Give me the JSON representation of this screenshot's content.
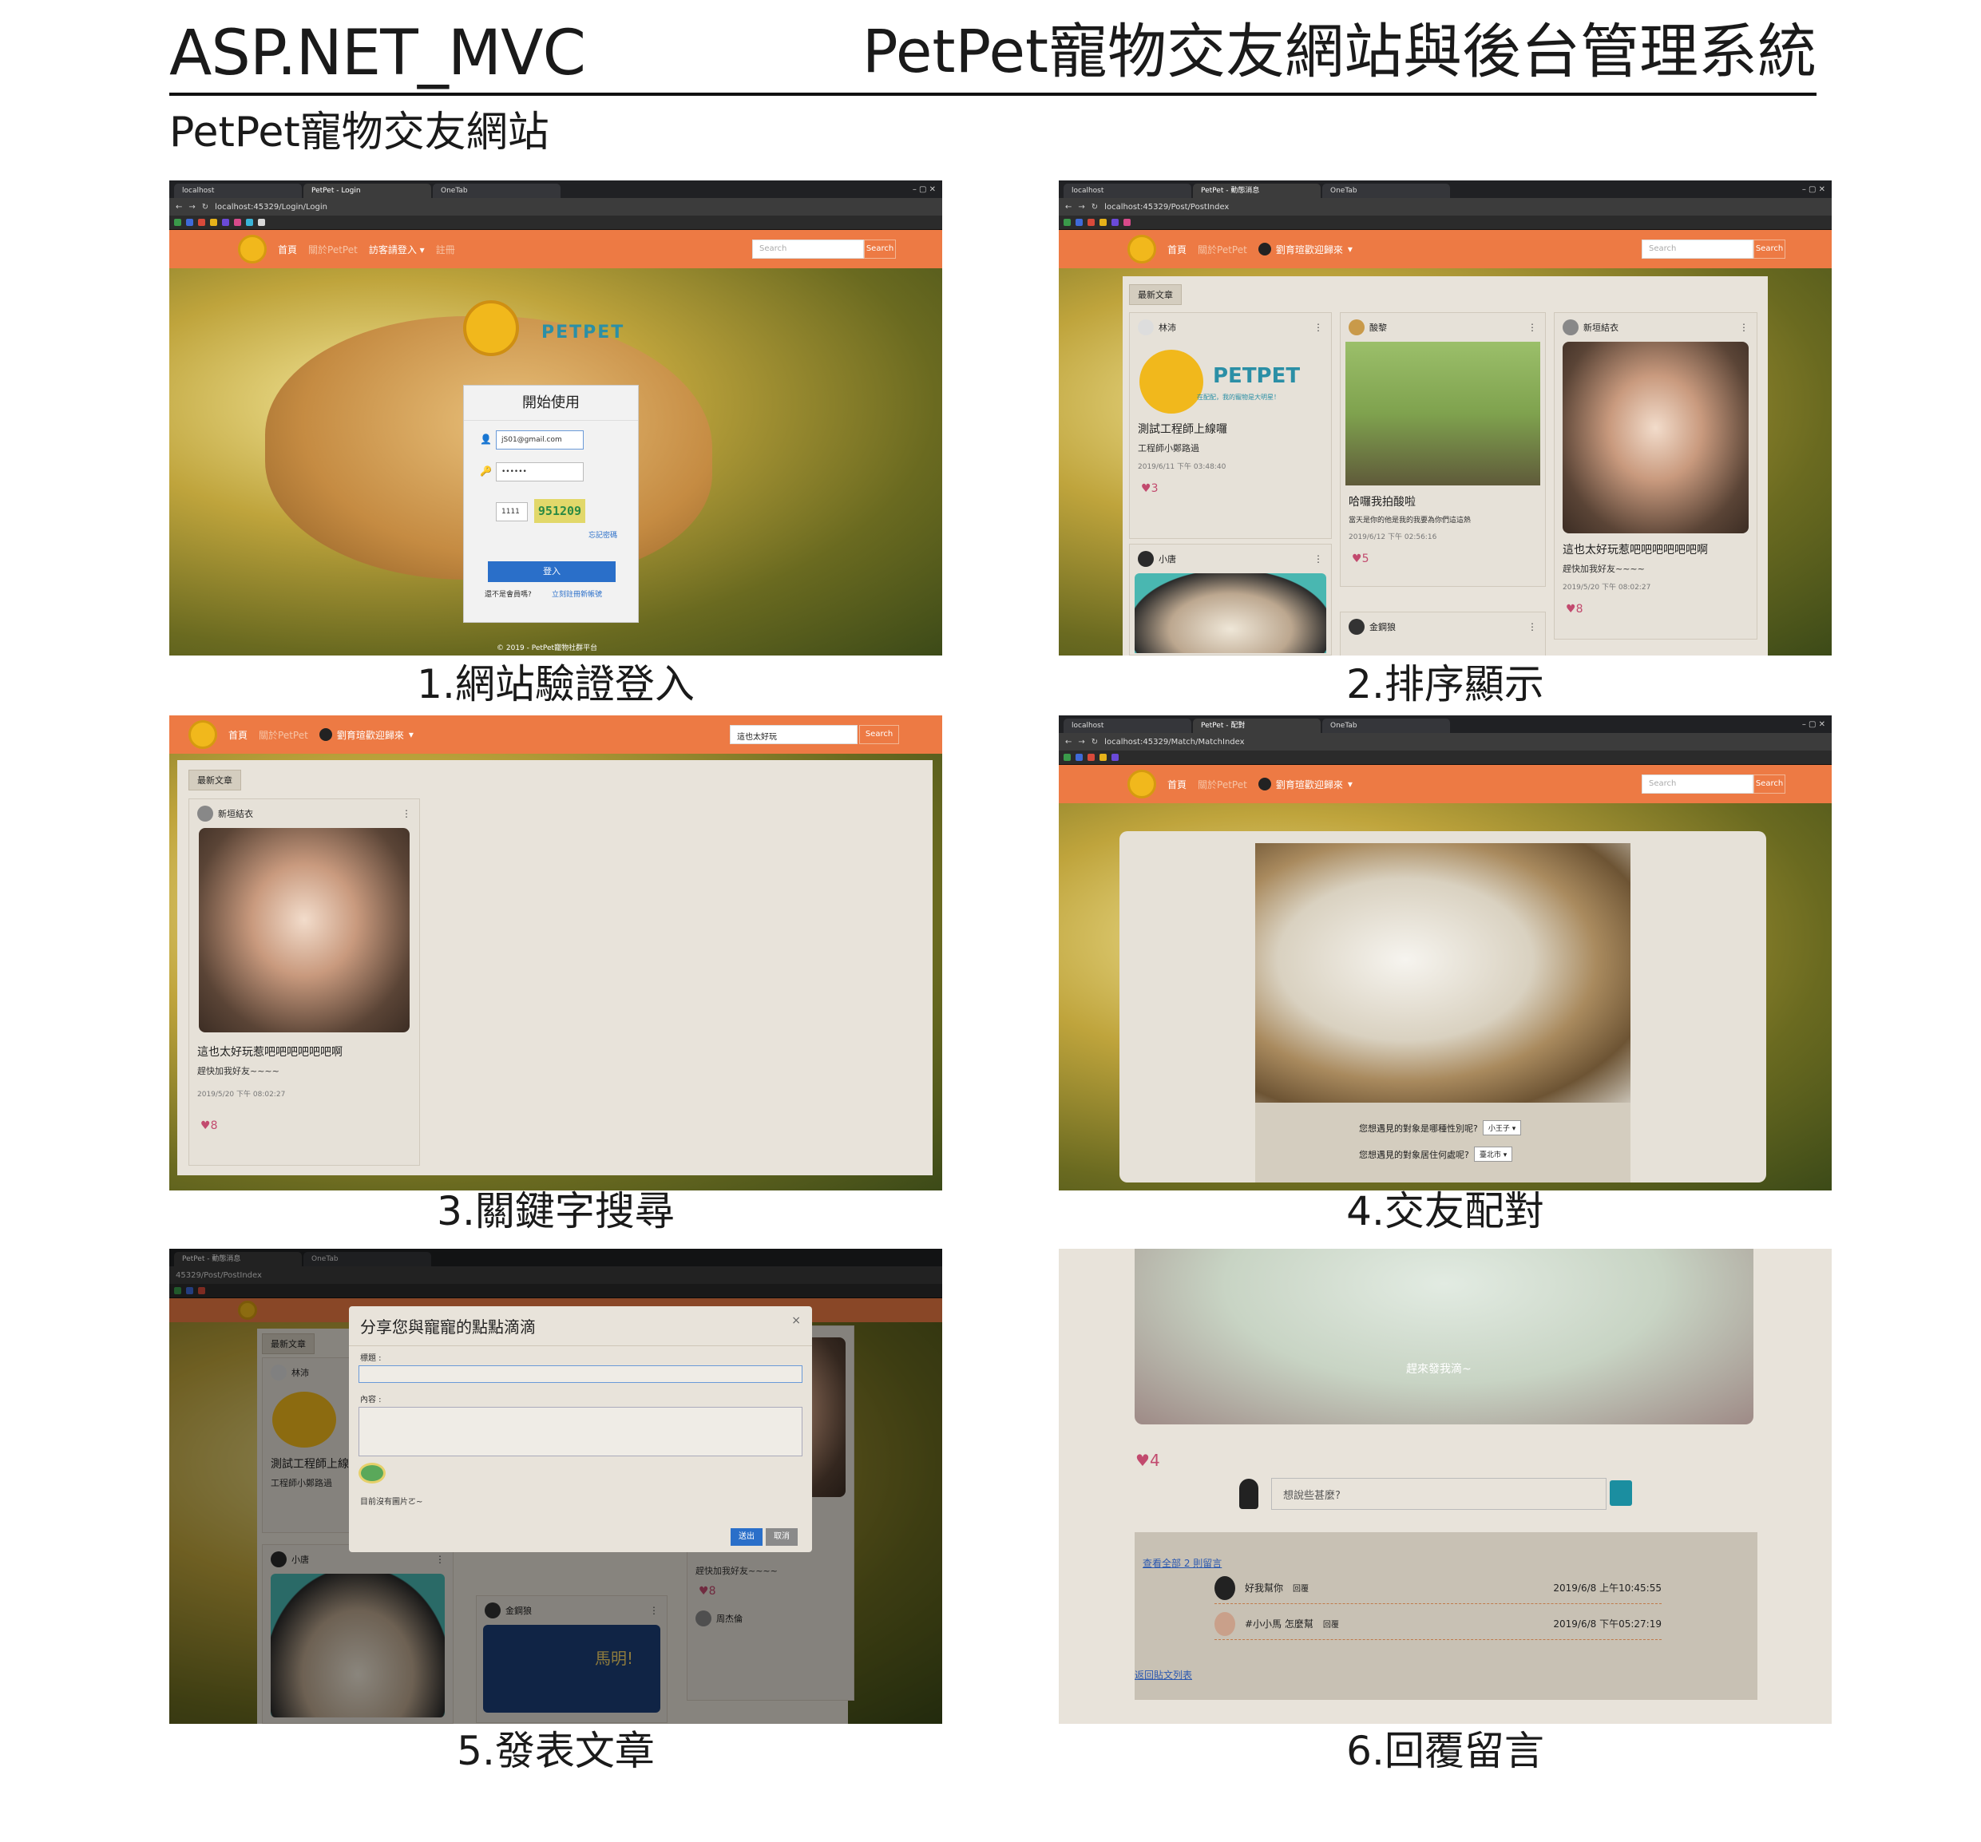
{
  "header": {
    "left_title": "ASP.NET_MVC",
    "right_title": "PetPet寵物交友網站與後台管理系統",
    "section_title": "PetPet寵物交友網站"
  },
  "captions": [
    "1.網站驗證登入",
    "2.排序顯示",
    "3.關鍵字搜尋",
    "4.交友配對",
    "5.發表文章",
    "6.回覆留言"
  ],
  "browser": {
    "tab_localhost": "localhost",
    "tab_onetab": "OneTab",
    "tab_login": "PetPet - Login",
    "tab_post": "PetPet - 動態消息",
    "tab_match": "PetPet - 配對",
    "url_login": "localhost:45329/Login/Login",
    "url_post": "localhost:45329/Post/PostIndex",
    "url_match": "localhost:45329/Match/MatchIndex",
    "url_post_partial": "45329/Post/PostIndex"
  },
  "nav": {
    "home": "首頁",
    "about": "關於PetPet",
    "guest_login": "訪客請登入",
    "guest_arrow": "▾",
    "register": "註冊",
    "user_greeting": "劉育瑄歡迎歸來",
    "search_placeholder": "Search",
    "search_value": "這也太好玩",
    "search_button": "Search"
  },
  "login": {
    "brand": "PETPET",
    "title": "開始使用",
    "email_value": "jS01@gmail.com",
    "password_value": "••••••",
    "captcha_input": "1111",
    "captcha_text": "951209",
    "forgot": "忘記密碼",
    "submit": "登入",
    "not_member": "還不是會員嗎?",
    "register_link": "立刻註冊新帳號",
    "footer": "© 2019 - PetPet寵物社群平台"
  },
  "feed": {
    "latest_tab": "最新文章",
    "posts": [
      {
        "user": "林沛",
        "title": "測試工程師上線囉",
        "body": "工程師小鄭路過",
        "date": "2019/6/11 下午 03:48:40",
        "likes": "3"
      },
      {
        "user": "酸黎",
        "title": "哈囉我拍酸啦",
        "body": "當天是你的他是我的我要為你們這這熱",
        "date": "2019/6/12 下午 02:56:16",
        "likes": "5"
      },
      {
        "user": "新垣結衣",
        "title": "這也太好玩惹吧吧吧吧吧吧啊",
        "body": "趕快加我好友~~~~",
        "date": "2019/5/20 下午 08:02:27",
        "likes": "8"
      },
      {
        "user": "小唐",
        "title": "",
        "body": "",
        "date": "",
        "likes": ""
      },
      {
        "user": "金鋼狼",
        "title": "",
        "body": "",
        "date": "",
        "likes": ""
      }
    ],
    "logo_brand": "PETPET",
    "logo_slogan": "在配配，我的寵物是大明星！",
    "poster_text": "馬明!",
    "extra_user": "周杰倫"
  },
  "match": {
    "q1": "您想遇見的對象是哪種性別呢?",
    "q1_value": "小王子",
    "q2": "您想遇見的對象居住何處呢?",
    "q2_value": "臺北市"
  },
  "compose": {
    "title": "分享您與寵寵的點點滴滴",
    "close": "×",
    "label_title": "標題 :",
    "label_content": "內容 :",
    "no_image": "目前沒有圖片ㄛ~",
    "submit": "送出",
    "cancel": "取消"
  },
  "reply": {
    "photo_overlay": "趕來發我滴~",
    "likes": "4",
    "comment_placeholder": "想說些甚麼?",
    "view_all": "查看全部 2 則留言",
    "comments": [
      {
        "user": "好我幫你",
        "action": "回覆",
        "time": "2019/6/8 上午10:45:55"
      },
      {
        "user": "#小小馬 怎麼幫",
        "action": "回覆",
        "time": "2019/6/8 下午05:27:19"
      }
    ],
    "back_link": "返回貼文列表"
  },
  "colors": {
    "nav_orange": "#ed7a44",
    "heart_pink": "#c24a6e",
    "button_blue": "#2a6fc9",
    "send_teal": "#1b8ea0"
  },
  "icons": [
    "heart-icon",
    "user-icon",
    "chat-send-icon",
    "kebab-menu-icon",
    "camera-icon",
    "close-icon"
  ]
}
